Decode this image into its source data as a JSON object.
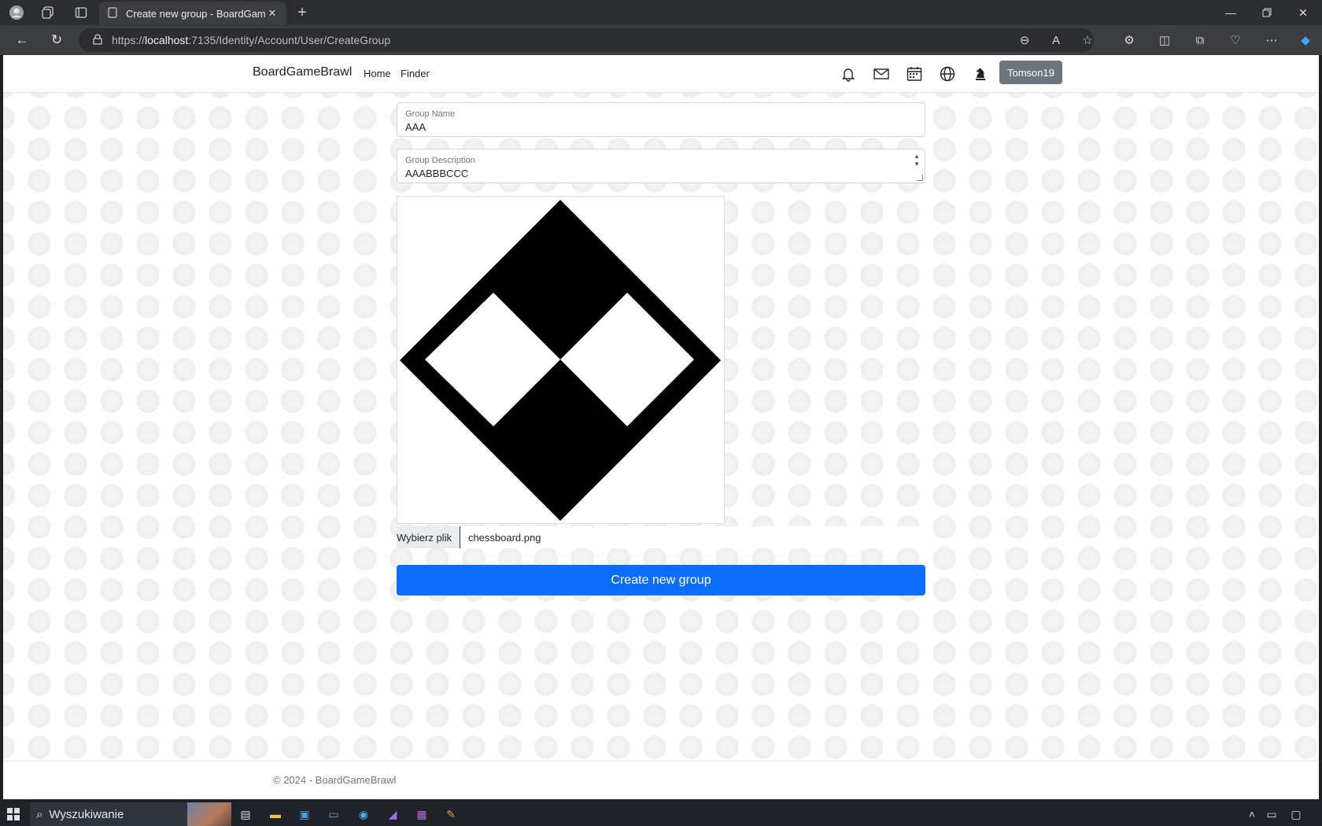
{
  "browser": {
    "tab_title": "Create new group - BoardGameBrawl",
    "url_prefix": "https://",
    "url_host": "localhost",
    "url_rest": ":7135/Identity/Account/User/CreateGroup"
  },
  "site": {
    "brand": "BoardGameBrawl",
    "nav": {
      "home": "Home",
      "finder": "Finder"
    },
    "user": "Tomson19"
  },
  "form": {
    "group_name": {
      "label": "Group Name",
      "value": "AAA"
    },
    "group_description": {
      "label": "Group Description",
      "value": "AAABBBCCC"
    },
    "file": {
      "button": "Wybierz plik",
      "filename": "chessboard.png"
    },
    "submit": "Create new group"
  },
  "footer": {
    "text": "© 2024 - BoardGameBrawl"
  },
  "taskbar": {
    "search_placeholder": "Wyszukiwanie"
  },
  "colors": {
    "primary": "#0d6efd",
    "user_button": "#6c757d"
  }
}
